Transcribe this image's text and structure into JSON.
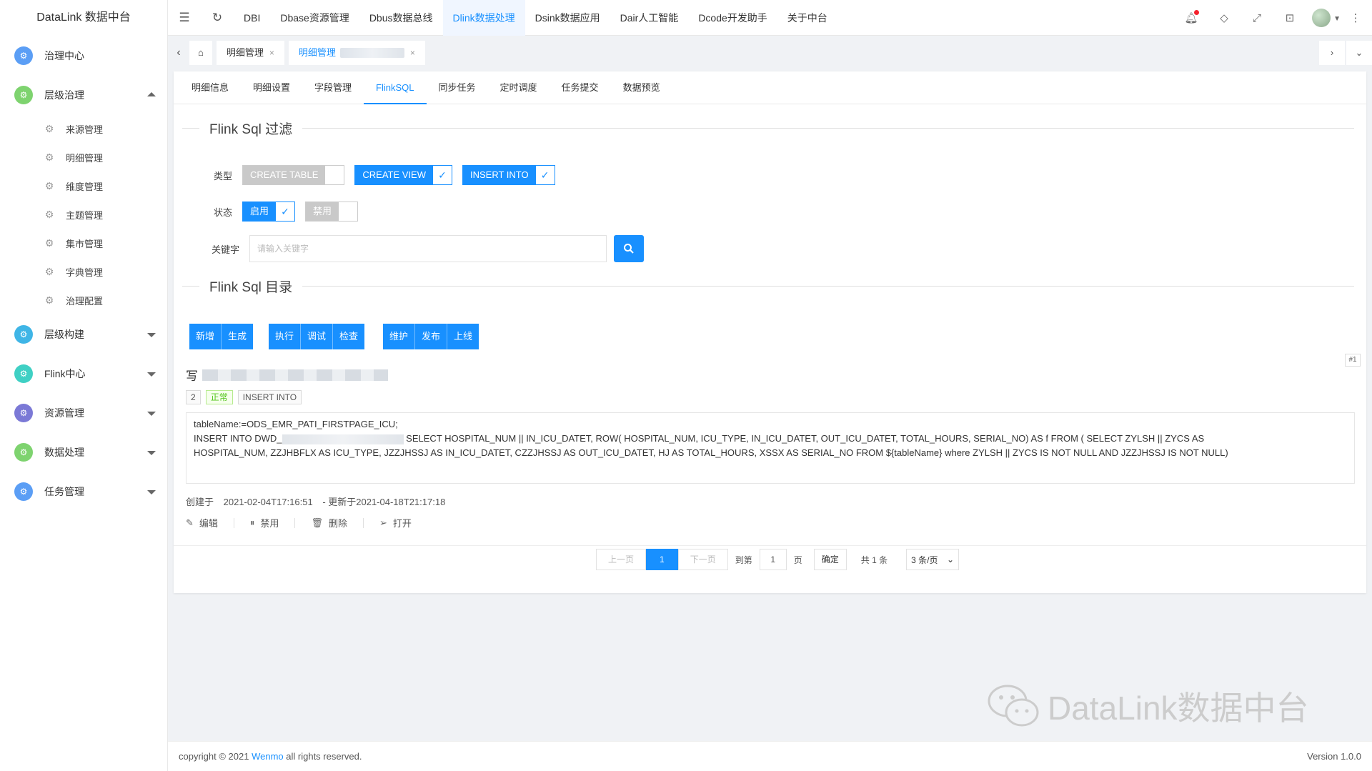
{
  "brand": "DataLink 数据中台",
  "sidebar": {
    "items": [
      {
        "label": "治理中心",
        "color": "#5b9ef5",
        "caret": ""
      },
      {
        "label": "层级治理",
        "color": "#7ed36f",
        "caret": "up"
      },
      {
        "label": "层级构建",
        "color": "#3fb5e6",
        "caret": "down"
      },
      {
        "label": "Flink中心",
        "color": "#3fd0c4",
        "caret": "down"
      },
      {
        "label": "资源管理",
        "color": "#7b79d6",
        "caret": "down"
      },
      {
        "label": "数据处理",
        "color": "#7ed36f",
        "caret": "down"
      },
      {
        "label": "任务管理",
        "color": "#5b9ef5",
        "caret": "down"
      }
    ],
    "sub_items": [
      "来源管理",
      "明细管理",
      "维度管理",
      "主题管理",
      "集市管理",
      "字典管理",
      "治理配置"
    ]
  },
  "topmenu": [
    "DBI",
    "Dbase资源管理",
    "Dbus数据总线",
    "Dlink数据处理",
    "Dsink数据应用",
    "Dair人工智能",
    "Dcode开发助手",
    "关于中台"
  ],
  "topmenu_active": 3,
  "page_tabs": {
    "tab1": "明细管理",
    "tab2": "明细管理"
  },
  "subtabs": [
    "明细信息",
    "明细设置",
    "字段管理",
    "FlinkSQL",
    "同步任务",
    "定时调度",
    "任务提交",
    "数据预览"
  ],
  "subtabs_active": 3,
  "filter": {
    "title": "Flink Sql 过滤",
    "type_label": "类型",
    "types": [
      {
        "label": "CREATE TABLE",
        "on": false
      },
      {
        "label": "CREATE VIEW",
        "on": true
      },
      {
        "label": "INSERT INTO",
        "on": true
      }
    ],
    "status_label": "状态",
    "statuses": [
      {
        "label": "启用",
        "on": true
      },
      {
        "label": "禁用",
        "on": false
      }
    ],
    "keyword_label": "关键字",
    "keyword_placeholder": "请输入关键字"
  },
  "catalog": {
    "title": "Flink Sql 目录",
    "group1": [
      "新增",
      "生成"
    ],
    "group2": [
      "执行",
      "调试",
      "检查"
    ],
    "group3": [
      "维护",
      "发布",
      "上线"
    ]
  },
  "item": {
    "pin": "#1",
    "title_prefix": "写",
    "tag_num": "2",
    "tag_status": "正常",
    "tag_type": "INSERT INTO",
    "code_line1": "tableName:=ODS_EMR_PATI_FIRSTPAGE_ICU;",
    "code_line2_a": "INSERT INTO DWD_",
    "code_line2_b": " SELECT HOSPITAL_NUM || IN_ICU_DATET, ROW( HOSPITAL_NUM, ICU_TYPE, IN_ICU_DATET, OUT_ICU_DATET, TOTAL_HOURS, SERIAL_NO) AS f FROM ( SELECT ZYLSH || ZYCS AS",
    "code_line3": "HOSPITAL_NUM, ZZJHBFLX AS ICU_TYPE, JZZJHSSJ AS IN_ICU_DATET, CZZJHSSJ AS OUT_ICU_DATET, HJ AS TOTAL_HOURS, XSSX AS SERIAL_NO FROM ${tableName} where ZYLSH || ZYCS IS NOT NULL AND JZZJHSSJ IS NOT NULL)",
    "created_label": "创建于",
    "created": "2021-02-04T17:16:51",
    "updated": "- 更新于2021-04-18T21:17:18",
    "actions": {
      "edit": "编辑",
      "disable": "禁用",
      "delete": "删除",
      "open": "打开"
    }
  },
  "pager": {
    "prev": "上一页",
    "current": "1",
    "next": "下一页",
    "goto_label": "到第",
    "goto_value": "1",
    "page_unit": "页",
    "ok": "确定",
    "total": "共 1 条",
    "per_page": "3 条/页"
  },
  "watermark": "DataLink数据中台",
  "footer": {
    "copyright_a": "copyright © 2021 ",
    "company": "Wenmo",
    "copyright_b": " all rights reserved.",
    "version": "Version 1.0.0"
  }
}
